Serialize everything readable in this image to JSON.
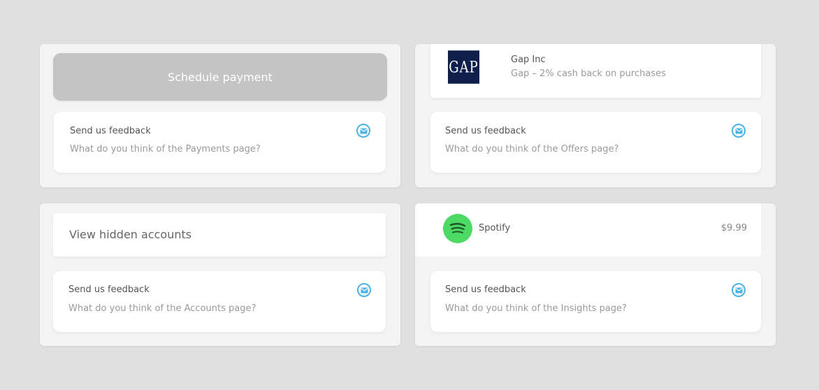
{
  "payments": {
    "schedule_button": "Schedule payment",
    "feedback": {
      "title": "Send us feedback",
      "subtitle": "What do you think of the Payments page?",
      "icon": "mail-icon"
    }
  },
  "offers": {
    "merchant": {
      "logo_text": "GAP",
      "name": "Gap Inc",
      "description": "Gap – 2% cash back on purchases"
    },
    "feedback": {
      "title": "Send us feedback",
      "subtitle": "What do you think of the Offers page?",
      "icon": "mail-icon"
    }
  },
  "accounts": {
    "hidden_accounts_label": "View hidden accounts",
    "feedback": {
      "title": "Send us feedback",
      "subtitle": "What do you think of the Accounts page?",
      "icon": "mail-icon"
    }
  },
  "insights": {
    "subscription": {
      "name": "Spotify",
      "amount": "$9.99",
      "icon": "spotify-icon"
    },
    "feedback": {
      "title": "Send us feedback",
      "subtitle": "What do you think of the Insights page?",
      "icon": "mail-icon"
    }
  },
  "colors": {
    "background": "#e0e0e0",
    "panel": "#f4f4f4",
    "card": "#ffffff",
    "button_disabled": "#c4c4c4",
    "mail_icon": "#4db3e6",
    "gap_navy": "#0e1f4b",
    "spotify_green": "#4cd964"
  }
}
